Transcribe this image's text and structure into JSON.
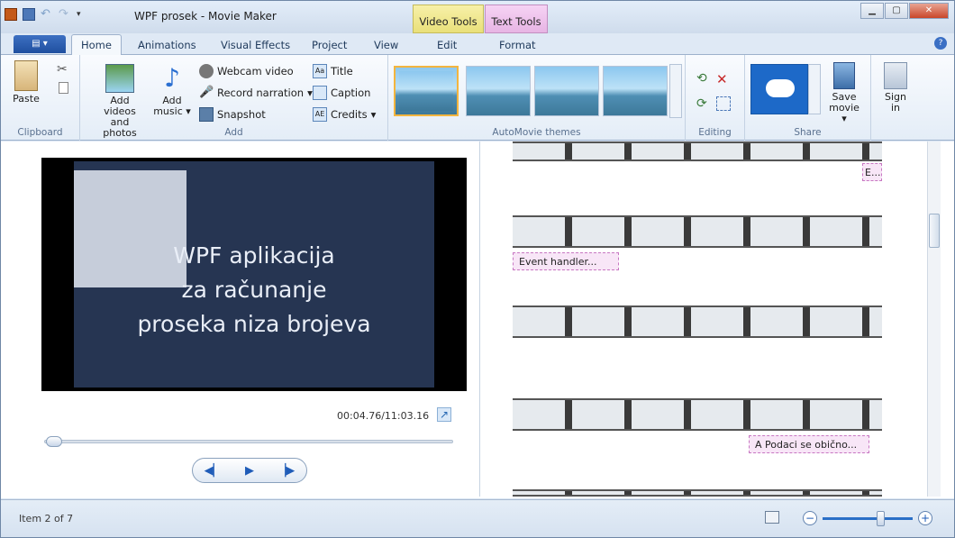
{
  "window": {
    "title": "WPF prosek - Movie Maker"
  },
  "context_tabs": {
    "video_tools": "Video Tools",
    "text_tools": "Text Tools"
  },
  "tabs": [
    "Home",
    "Animations",
    "Visual Effects",
    "Project",
    "View",
    "Edit",
    "Format"
  ],
  "ribbon": {
    "clipboard": {
      "paste": "Paste",
      "label": "Clipboard"
    },
    "add": {
      "add_videos_line1": "Add videos",
      "add_videos_line2": "and photos",
      "add_music_line1": "Add",
      "add_music_line2": "music",
      "webcam": "Webcam video",
      "record": "Record narration",
      "snapshot": "Snapshot",
      "title": "Title",
      "caption": "Caption",
      "credits": "Credits",
      "label": "Add"
    },
    "themes": {
      "label": "AutoMovie themes"
    },
    "editing": {
      "label": "Editing"
    },
    "share": {
      "save_line1": "Save",
      "save_line2": "movie",
      "sign_line1": "Sign",
      "sign_line2": "in",
      "label": "Share"
    }
  },
  "preview": {
    "title_lines": [
      "WPF aplikacija",
      "za računanje",
      "proseka niza brojeva"
    ],
    "timecode": "00:04.76/11:03.16",
    "seek_fraction": 0.007
  },
  "storyboard": {
    "captions": [
      "E...",
      "Event handler...",
      "A Podaci se obično..."
    ]
  },
  "status": {
    "item": "Item 2 of 7"
  },
  "zoom": {
    "level_fraction": 0.6
  }
}
